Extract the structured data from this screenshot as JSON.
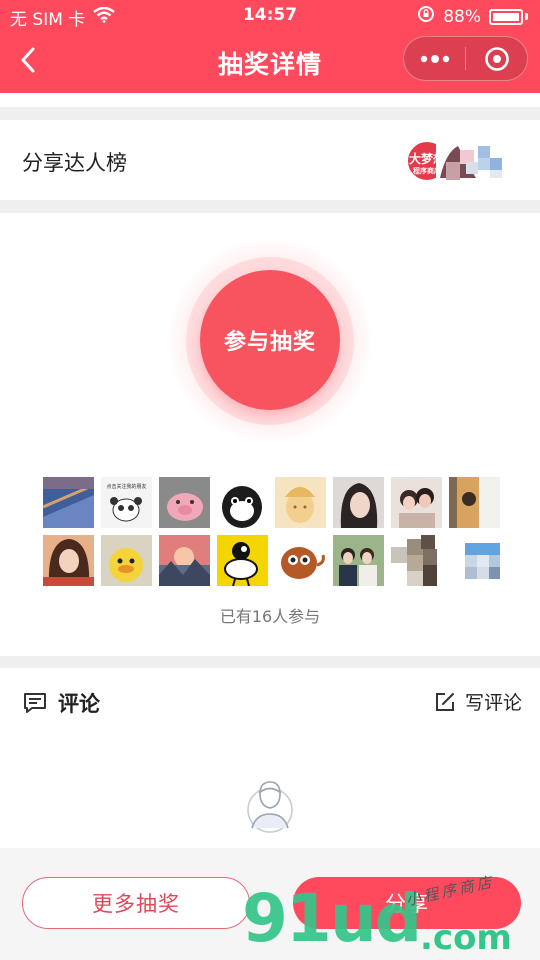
{
  "status_bar": {
    "carrier": "无 SIM 卡",
    "time": "14:57",
    "battery": "88%",
    "icons": [
      "wifi-icon",
      "orientation-lock-icon",
      "battery-icon"
    ]
  },
  "navbar": {
    "title": "抽奖详情",
    "back_icon": "chevron-left-icon",
    "capsule_icons": [
      "more-dots-icon",
      "close-circle-icon"
    ]
  },
  "share_section": {
    "title": "分享达人榜",
    "badge_text_line1": "大梦想",
    "badge_text_line2": "程序商店"
  },
  "lottery": {
    "join_label": "参与抽奖",
    "participants_text": "已有16人参与",
    "participant_count": 16,
    "avatar_row1_caption": "点击关注我的朋友"
  },
  "comments": {
    "title": "评论",
    "write_label": "写评论"
  },
  "bottom_bar": {
    "more_label": "更多抽奖",
    "share_label": "分享"
  },
  "watermark": {
    "brand": "91ud",
    "domain": ".com",
    "script": "小程序商店"
  },
  "colors": {
    "brand_red": "#ff4a5e",
    "watermark_green": "#35c58a"
  }
}
